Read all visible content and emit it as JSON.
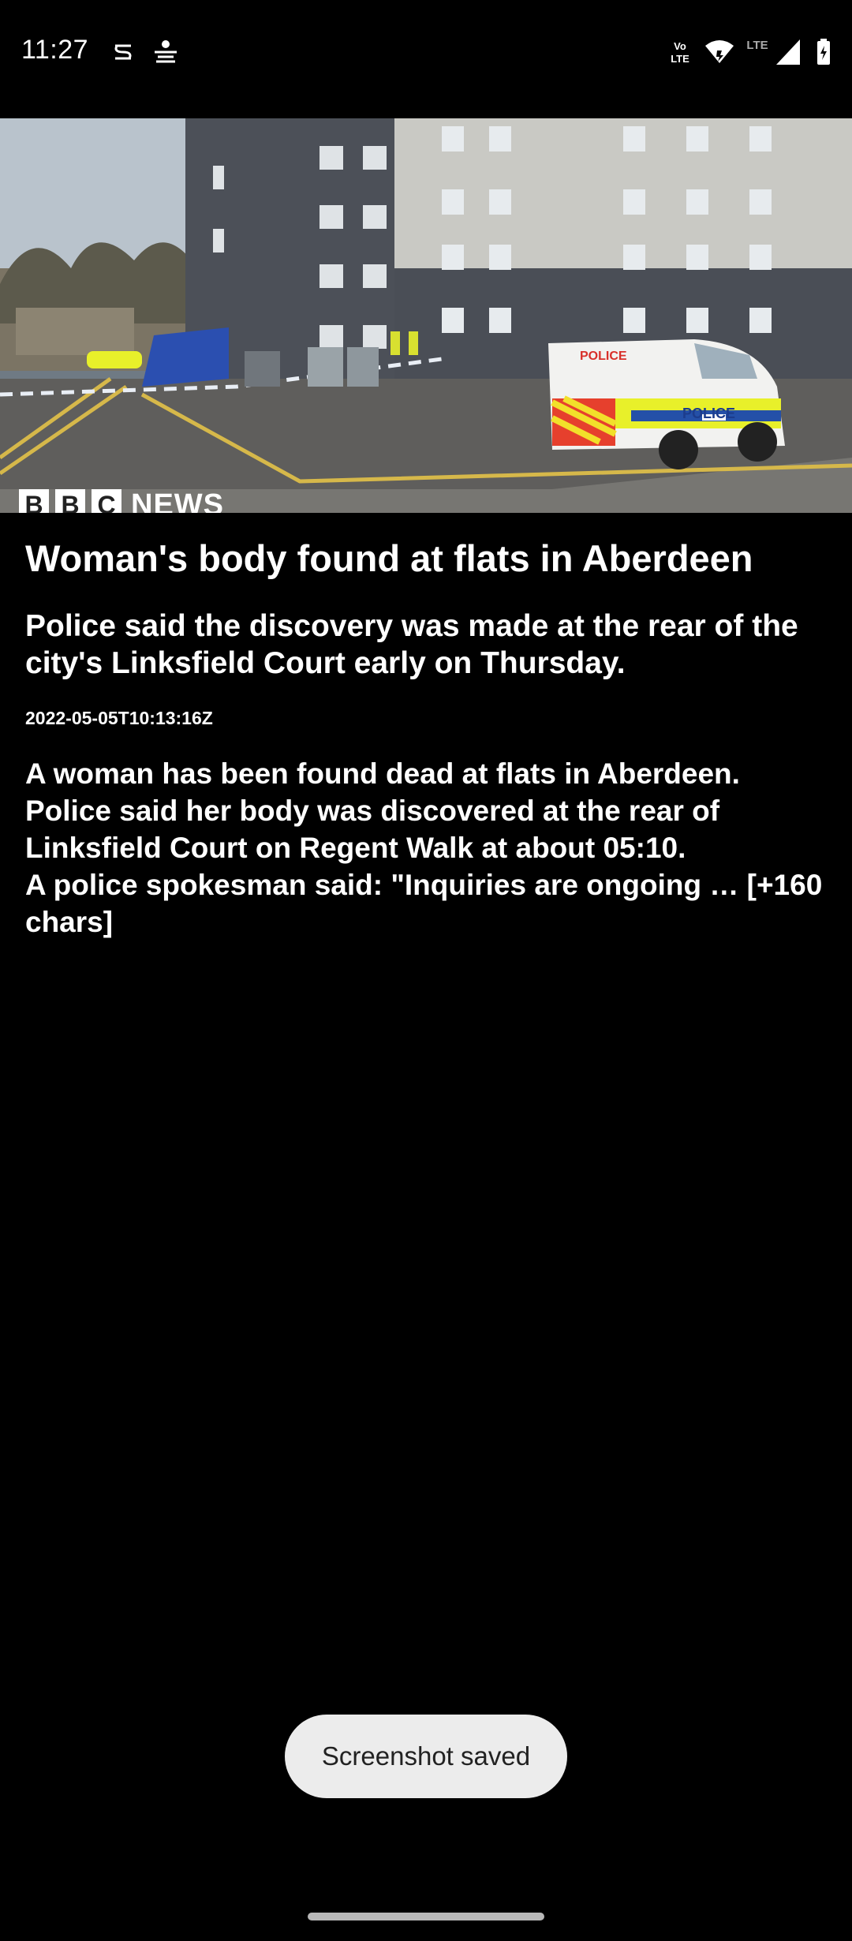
{
  "status_bar": {
    "time": "11:27",
    "left_icons": [
      "location-sync-icon",
      "dainik-bhaskar-app-icon"
    ],
    "right_icons": [
      "volte-icon",
      "wifi-icon",
      "lte-icon",
      "signal-icon",
      "battery-charging-icon"
    ],
    "volte_label": "Vo LTE",
    "lte_label": "LTE"
  },
  "article": {
    "image_watermark": {
      "letters": [
        "B",
        "B",
        "C"
      ],
      "news": "NEWS"
    },
    "headline": "Woman's body found at flats in Aberdeen",
    "summary": "Police said the discovery was made at the rear of the city's Linksfield Court early on Thursday.",
    "timestamp": "2022-05-05T10:13:16Z",
    "body": {
      "line1": "A woman has been found dead at flats in Aberdeen.",
      "line2": "Police said her body was discovered at the rear of Linksfield Court on Regent Walk at about 05:10.",
      "line3": "A police spokesman said: \"Inquiries are ongoing … [+160 chars]"
    },
    "van_label": "POLICE",
    "van_label_small": "POLICE"
  },
  "toast": {
    "text": "Screenshot saved"
  },
  "colors": {
    "background": "#000000",
    "text": "#ffffff",
    "toast_bg": "#ececec",
    "police_yellow": "#e8f02a"
  }
}
